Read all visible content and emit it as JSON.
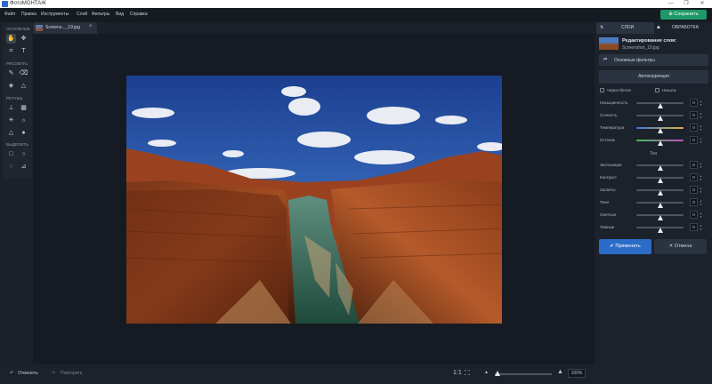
{
  "titlebar": {
    "title": "ФотоМОНТАЖ",
    "minimize": "—",
    "maximize": "❐",
    "close": "✕"
  },
  "menubar": {
    "items": [
      "Файл",
      "Правка",
      "Инструменты",
      "Слой",
      "Фильтры",
      "Вид",
      "Справка"
    ],
    "save_label": "Сохранить"
  },
  "tools": {
    "sections": [
      "ОСНОВНЫЕ",
      "РИСОВАТЬ",
      "РЕТУШЬ",
      "ВЫДЕЛИТЬ"
    ]
  },
  "document": {
    "tab_name": "Screens..._19.jpg",
    "close": "×"
  },
  "bottom": {
    "undo": "Отменить",
    "redo": "Повторить",
    "ratio": "1:1",
    "zoom": "100%",
    "zoom_fraction": 0.04
  },
  "right": {
    "tab_layers": "СЛОИ",
    "tab_processing": "ОБРАБОТКА",
    "edit_title": "Редактирование слоя:",
    "edit_file": "Screenshot_19.jpg",
    "basic_filters": "Основные фильтры",
    "autocorrect": "Автокоррекция",
    "bw": "Черно-белое",
    "sepia": "Насыпь",
    "sliders": [
      {
        "label": "Насыщенность",
        "value": "0",
        "pos": 0.5
      },
      {
        "label": "Сочность",
        "value": "0",
        "pos": 0.5
      },
      {
        "label": "Температура",
        "value": "0",
        "pos": 0.5
      },
      {
        "label": "Оттенок",
        "value": "0",
        "pos": 0.5
      }
    ],
    "tone_label": "Тон",
    "tone_sliders": [
      {
        "label": "Экспозиция",
        "value": "0",
        "pos": 0.5
      },
      {
        "label": "Контраст",
        "value": "0",
        "pos": 0.5
      },
      {
        "label": "Засветы",
        "value": "0",
        "pos": 0.5
      },
      {
        "label": "Тени",
        "value": "0",
        "pos": 0.5
      },
      {
        "label": "Светлые",
        "value": "0",
        "pos": 0.5
      },
      {
        "label": "Темные",
        "value": "0",
        "pos": 0.5
      }
    ],
    "apply": "Применить",
    "cancel": "Отмена"
  },
  "colors": {
    "accent": "#1e9a6a",
    "apply_bg": "#2a6cc7"
  }
}
